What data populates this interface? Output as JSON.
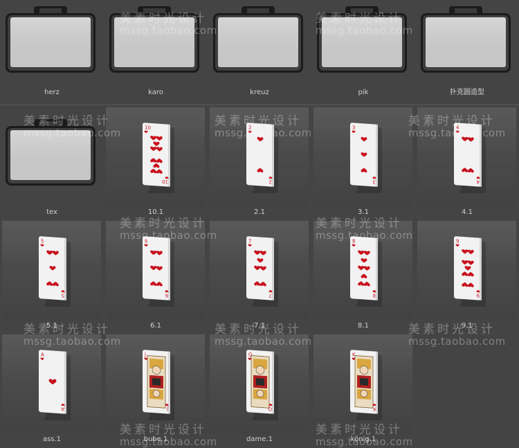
{
  "window": {
    "items": [
      {
        "label": "herz",
        "kind": "folder"
      },
      {
        "label": "karo",
        "kind": "folder"
      },
      {
        "label": "kreuz",
        "kind": "folder"
      },
      {
        "label": "pik",
        "kind": "folder"
      },
      {
        "label": "扑克圆造型",
        "kind": "folder"
      },
      {
        "label": "tex",
        "kind": "folder"
      },
      {
        "label": "10.1",
        "kind": "card",
        "pips": 10,
        "rank": "10"
      },
      {
        "label": "2.1",
        "kind": "card",
        "pips": 2,
        "rank": "2"
      },
      {
        "label": "3.1",
        "kind": "card",
        "pips": 3,
        "rank": "3"
      },
      {
        "label": "4.1",
        "kind": "card",
        "pips": 4,
        "rank": "4"
      },
      {
        "label": "5.1",
        "kind": "card",
        "pips": 5,
        "rank": "5"
      },
      {
        "label": "6.1",
        "kind": "card",
        "pips": 6,
        "rank": "6"
      },
      {
        "label": "7.1",
        "kind": "card",
        "pips": 7,
        "rank": "7"
      },
      {
        "label": "8.1",
        "kind": "card",
        "pips": 8,
        "rank": "8"
      },
      {
        "label": "9.1",
        "kind": "card",
        "pips": 9,
        "rank": "9"
      },
      {
        "label": "ass.1",
        "kind": "card",
        "pips": 1,
        "rank": "A"
      },
      {
        "label": "bube.1",
        "kind": "face",
        "rank": "J"
      },
      {
        "label": "dame.1",
        "kind": "face",
        "rank": "Q"
      },
      {
        "label": "könig.1",
        "kind": "face",
        "rank": "K"
      }
    ]
  },
  "watermark": {
    "cn": "美素时光设计",
    "en": "mssg.taobao.com"
  },
  "colors": {
    "background": "#444444",
    "suit_red": "#c8101c",
    "label": "#d2d2d2"
  }
}
